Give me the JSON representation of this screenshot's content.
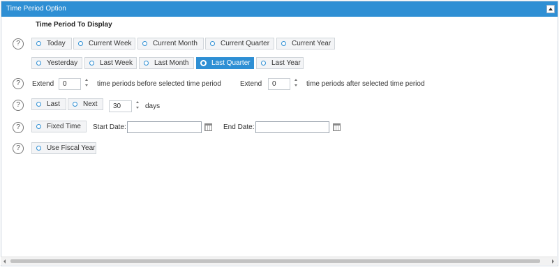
{
  "panel": {
    "title": "Time Period Option",
    "collapse_icon": "triangle-up"
  },
  "heading": "Time Period To Display",
  "help_glyph": "?",
  "row1": [
    "Today",
    "Current Week",
    "Current Month",
    "Current Quarter",
    "Current Year"
  ],
  "row2": [
    "Yesterday",
    "Last Week",
    "Last Month",
    "Last Quarter",
    "Last Year"
  ],
  "selected": "Last Quarter",
  "extend": {
    "label": "Extend",
    "before_value": "0",
    "before_text": "time periods before selected time period",
    "after_value": "0",
    "after_text": "time periods after selected time period"
  },
  "lastnext": {
    "last": "Last",
    "next": "Next",
    "value": "30",
    "unit": "days"
  },
  "fixed": {
    "label": "Fixed Time",
    "start_label": "Start Date:",
    "start_value": "",
    "end_label": "End Date:",
    "end_value": ""
  },
  "fiscal": {
    "label": "Use Fiscal Year"
  },
  "colors": {
    "accent": "#2e8fd4"
  }
}
